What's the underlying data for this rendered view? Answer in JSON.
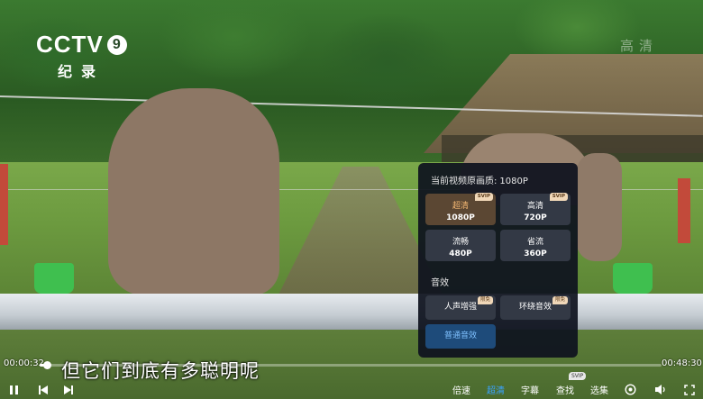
{
  "channel": {
    "brand": "CCTV",
    "number": "9",
    "name": "纪录"
  },
  "watermark": "高清",
  "subtitle": "但它们到底有多聪明呢",
  "player": {
    "current_time": "00:00:32",
    "total_time": "00:48:30",
    "progress_fraction": 0.011
  },
  "controls": {
    "speed": "倍速",
    "quality": "超清",
    "captions": "字幕",
    "search": "查找",
    "episodes": "选集",
    "svip_badge": "SVIP"
  },
  "quality_panel": {
    "current_label": "当前视频原画质:",
    "current_value": "1080P",
    "options": [
      {
        "name": "超清",
        "res": "1080P",
        "tag": "SVIP",
        "selected": true
      },
      {
        "name": "高清",
        "res": "720P",
        "tag": "SVIP",
        "selected": false
      },
      {
        "name": "流畅",
        "res": "480P",
        "tag": "",
        "selected": false
      },
      {
        "name": "省流",
        "res": "360P",
        "tag": "",
        "selected": false
      }
    ],
    "audio_section": "音效",
    "audio_options": [
      {
        "name": "人声增强",
        "tag": "限免"
      },
      {
        "name": "环绕音效",
        "tag": "限免"
      },
      {
        "name": "普通音效",
        "tag": "",
        "active": true
      }
    ]
  },
  "colors": {
    "accent": "#3aa3ff",
    "selected_quality": "#f5b873",
    "panel_bg": "#0e121e"
  }
}
